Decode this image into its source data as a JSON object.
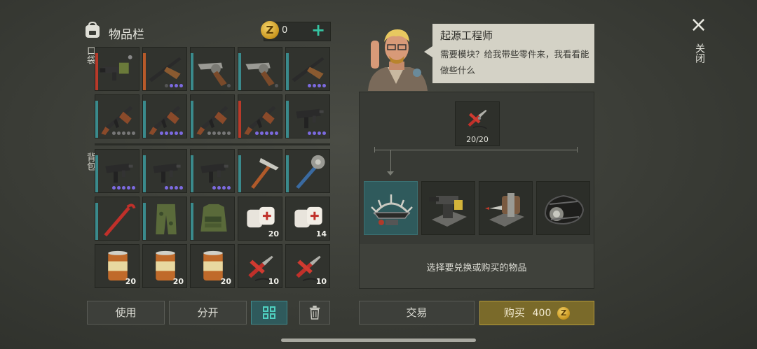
{
  "header": {
    "title": "物品栏",
    "coins": "0",
    "add_label": "+",
    "coin_symbol": "Z"
  },
  "sections": {
    "pocket": "口袋",
    "backpack": "背包"
  },
  "pocket_items": [
    {
      "name": "grenade-launcher",
      "bar": "#b83a2a",
      "dots": []
    },
    {
      "name": "shotgun",
      "bar": "#b85a2a",
      "dots": [
        "#555",
        "#7c6ae0",
        "#7c6ae0",
        "#7c6ae0"
      ]
    },
    {
      "name": "revolver",
      "bar": "#3a8a8c",
      "dots": [
        "#555"
      ]
    },
    {
      "name": "revolver",
      "bar": "#3a8a8c",
      "dots": [
        "#555"
      ]
    },
    {
      "name": "shotgun",
      "bar": "#3a8a8c",
      "dots": [
        "#7c6ae0",
        "#7c6ae0",
        "#7c6ae0",
        "#7c6ae0"
      ]
    },
    {
      "name": "assault-rifle",
      "bar": "#3a8a8c",
      "dots": [
        "#777",
        "#777",
        "#777",
        "#777",
        "#777"
      ]
    },
    {
      "name": "assault-rifle",
      "bar": "#3a8a8c",
      "dots": [
        "#7c6ae0",
        "#7c6ae0",
        "#7c6ae0",
        "#7c6ae0",
        "#7c6ae0"
      ]
    },
    {
      "name": "assault-rifle",
      "bar": "#3a8a8c",
      "dots": [
        "#777",
        "#777",
        "#777",
        "#777",
        "#777"
      ]
    },
    {
      "name": "assault-rifle",
      "bar": "#b83a2a",
      "dots": [
        "#7c6ae0",
        "#7c6ae0",
        "#7c6ae0",
        "#7c6ae0",
        "#7c6ae0"
      ]
    },
    {
      "name": "smg",
      "bar": "#3a8a8c",
      "dots": [
        "#7c6ae0",
        "#7c6ae0",
        "#7c6ae0",
        "#7c6ae0"
      ]
    }
  ],
  "backpack_items": [
    {
      "name": "smg",
      "bar": "#3a8a8c",
      "dots": [
        "#7c6ae0",
        "#7c6ae0",
        "#7c6ae0",
        "#7c6ae0",
        "#7c6ae0"
      ],
      "qty": ""
    },
    {
      "name": "smg",
      "bar": "#3a8a8c",
      "dots": [
        "#7c6ae0",
        "#7c6ae0",
        "#7c6ae0",
        "#7c6ae0"
      ],
      "qty": ""
    },
    {
      "name": "smg",
      "bar": "#3a8a8c",
      "dots": [
        "#7c6ae0",
        "#7c6ae0",
        "#7c6ae0",
        "#7c6ae0"
      ],
      "qty": ""
    },
    {
      "name": "ice-axe",
      "bar": "#3a8a8c",
      "dots": [],
      "qty": ""
    },
    {
      "name": "saw-mace",
      "bar": "#3a8a8c",
      "dots": [],
      "qty": ""
    },
    {
      "name": "crowbar",
      "bar": "#3a8a8c",
      "dots": [],
      "qty": ""
    },
    {
      "name": "camo-pants",
      "bar": "#3a8a8c",
      "dots": [],
      "qty": ""
    },
    {
      "name": "camo-vest",
      "bar": "#3a8a8c",
      "dots": [],
      "qty": ""
    },
    {
      "name": "bandage",
      "bar": "",
      "dots": [],
      "qty": "20"
    },
    {
      "name": "bandage",
      "bar": "",
      "dots": [],
      "qty": "14"
    },
    {
      "name": "food-can",
      "bar": "",
      "dots": [],
      "qty": "20"
    },
    {
      "name": "food-can",
      "bar": "",
      "dots": [],
      "qty": "20"
    },
    {
      "name": "food-can",
      "bar": "",
      "dots": [],
      "qty": "20"
    },
    {
      "name": "pliers-wire",
      "bar": "",
      "dots": [],
      "qty": "10"
    },
    {
      "name": "pliers-wire",
      "bar": "",
      "dots": [],
      "qty": "10"
    }
  ],
  "left_buttons": {
    "use": "使用",
    "split": "分开"
  },
  "npc": {
    "name": "起源工程师",
    "text": "需要模块？给我带些零件来，我看看能做些什么"
  },
  "requirement": {
    "count": "20/20"
  },
  "options": [
    "spiked-frame",
    "turret-mount",
    "drill-machine",
    "track-module"
  ],
  "hint": "选择要兑换或购买的物品",
  "actions": {
    "trade": "交易",
    "buy": "购买",
    "price": "400"
  },
  "close": {
    "label": "关闭",
    "icon": "×"
  }
}
